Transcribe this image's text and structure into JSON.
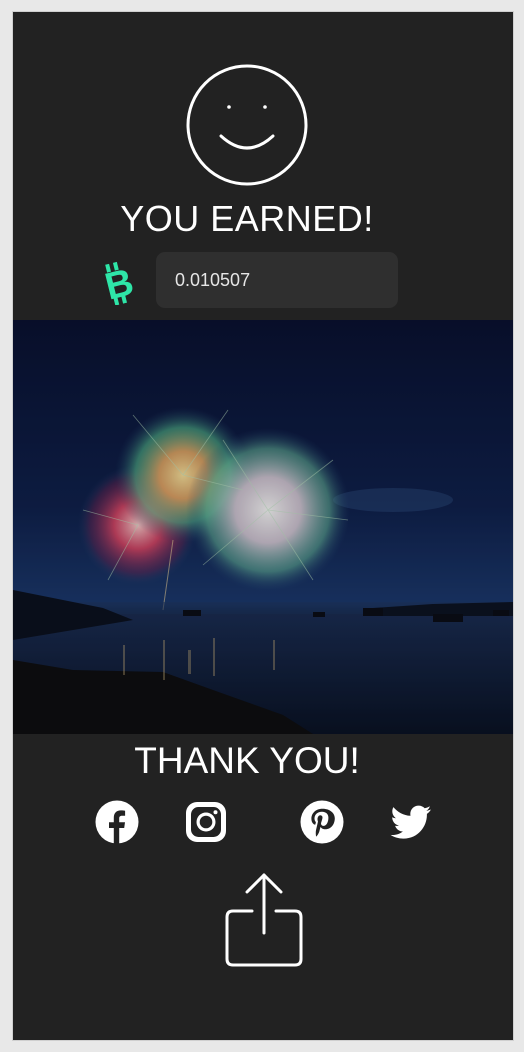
{
  "header": {
    "title": "YOU EARNED!",
    "icon": "smiley-face-icon"
  },
  "earnings": {
    "currency_icon": "bitcoin-cash-icon",
    "currency_color": "#2ee6a8",
    "amount": "0.010507"
  },
  "image": {
    "subject": "fireworks-over-harbor-at-night"
  },
  "footer": {
    "title": "THANK YOU!",
    "social": [
      {
        "name": "facebook",
        "icon": "facebook-icon"
      },
      {
        "name": "instagram",
        "icon": "instagram-icon"
      },
      {
        "name": "pinterest",
        "icon": "pinterest-icon"
      },
      {
        "name": "twitter",
        "icon": "twitter-icon"
      }
    ],
    "share_icon": "share-icon"
  },
  "colors": {
    "background": "#222222",
    "text": "#ffffff",
    "input_bg": "#2f2f2f"
  }
}
